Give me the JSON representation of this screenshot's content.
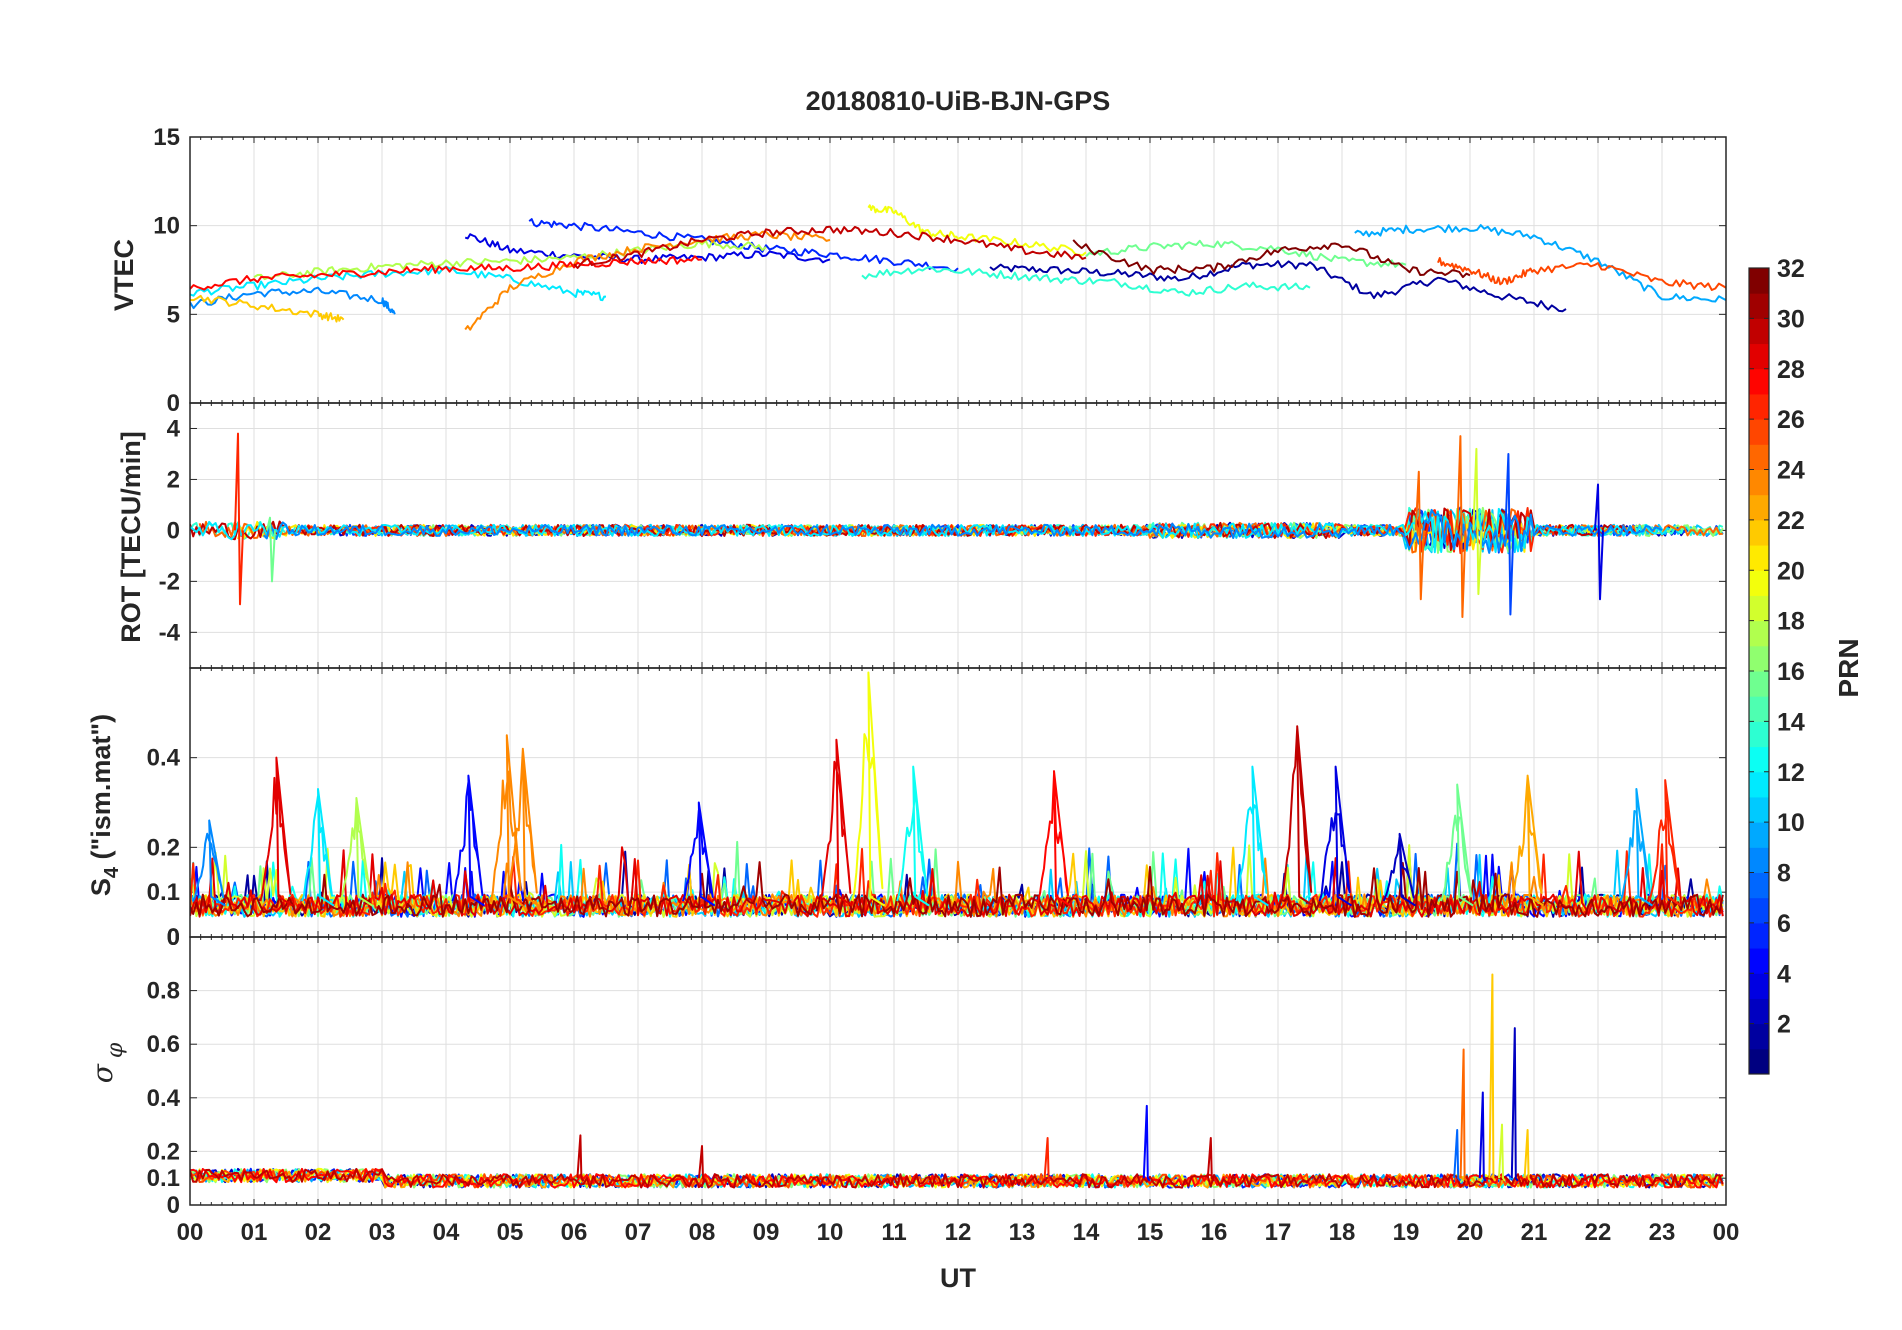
{
  "figure_title": "20180810-UiB-BJN-GPS",
  "colorbar": {
    "label": "PRN",
    "min": 1,
    "max": 32,
    "colormap": "jet",
    "ticks": [
      "2",
      "4",
      "6",
      "8",
      "10",
      "12",
      "14",
      "16",
      "18",
      "20",
      "22",
      "24",
      "26",
      "28",
      "30",
      "32"
    ]
  },
  "chart_data": [
    {
      "type": "line",
      "panel": "VTEC",
      "title": "20180810-UiB-BJN-GPS",
      "ylabel": "VTEC",
      "xlim": [
        0,
        24
      ],
      "ylim": [
        0,
        15
      ],
      "yticks": [
        0,
        5,
        10,
        15
      ],
      "grid": true,
      "series_by_prn": [
        {
          "prn": 2,
          "x": [
            12.5,
            13.5,
            14.5,
            15.5,
            16.5,
            17.5,
            18.5,
            19.5,
            20.5,
            21.5
          ],
          "y": [
            7.6,
            7.5,
            7.3,
            7.0,
            7.8,
            7.8,
            6.0,
            7.0,
            6.0,
            5.3
          ]
        },
        {
          "prn": 4,
          "x": [
            4.3,
            5.0,
            6.0,
            7.0,
            8.0,
            9.0,
            10.0
          ],
          "y": [
            9.5,
            8.6,
            8.3,
            8.1,
            8.2,
            8.4,
            8.1
          ]
        },
        {
          "prn": 6,
          "x": [
            5.3,
            6.0,
            7.0,
            8.0,
            9.0,
            10.0,
            11.0,
            12.0
          ],
          "y": [
            10.2,
            10.0,
            9.6,
            9.2,
            8.7,
            8.4,
            8.0,
            7.6
          ]
        },
        {
          "prn": 9,
          "x": [
            0.0,
            1.0,
            2.0,
            3.0,
            3.2
          ],
          "y": [
            5.5,
            6.2,
            6.3,
            5.8,
            5.0
          ]
        },
        {
          "prn": 10,
          "x": [
            18.2,
            19.0,
            20.0,
            21.0,
            22.0,
            23.0,
            24.0
          ],
          "y": [
            9.5,
            9.8,
            9.9,
            9.4,
            8.0,
            6.0,
            5.8
          ]
        },
        {
          "prn": 12,
          "x": [
            0.0,
            1.0,
            2.0,
            3.0,
            4.0,
            5.0,
            6.0,
            6.5
          ],
          "y": [
            6.2,
            6.6,
            7.0,
            7.3,
            7.5,
            7.0,
            6.2,
            6.0
          ]
        },
        {
          "prn": 14,
          "x": [
            10.5,
            11.5,
            12.5,
            13.5,
            14.5,
            15.5,
            16.5,
            17.5
          ],
          "y": [
            7.2,
            7.6,
            7.3,
            7.0,
            6.8,
            6.2,
            6.6,
            6.5
          ]
        },
        {
          "prn": 16,
          "x": [
            14.0,
            15.0,
            16.0,
            17.0,
            18.0,
            19.0
          ],
          "y": [
            8.4,
            8.8,
            9.0,
            8.7,
            8.0,
            7.8
          ]
        },
        {
          "prn": 18,
          "x": [
            1.0,
            2.0,
            3.0,
            4.0,
            5.0,
            6.0,
            7.0,
            8.0,
            9.0
          ],
          "y": [
            7.0,
            7.4,
            7.7,
            7.9,
            8.0,
            8.2,
            8.6,
            9.0,
            8.8
          ]
        },
        {
          "prn": 20,
          "x": [
            10.6,
            11.0,
            11.5,
            12.0,
            13.0,
            14.0
          ],
          "y": [
            11.0,
            10.8,
            9.6,
            9.4,
            9.0,
            8.5
          ]
        },
        {
          "prn": 22,
          "x": [
            0.0,
            1.0,
            2.0,
            2.4
          ],
          "y": [
            6.0,
            5.5,
            5.0,
            4.7
          ]
        },
        {
          "prn": 24,
          "x": [
            4.3,
            5.0,
            6.0,
            7.0,
            8.0,
            9.0,
            10.0
          ],
          "y": [
            4.0,
            6.5,
            8.0,
            8.7,
            9.2,
            9.5,
            9.2
          ]
        },
        {
          "prn": 26,
          "x": [
            19.5,
            20.0,
            20.5,
            21.0,
            22.0,
            23.0,
            24.0
          ],
          "y": [
            8.0,
            7.5,
            6.8,
            7.5,
            7.8,
            6.8,
            6.5
          ]
        },
        {
          "prn": 28,
          "x": [
            0.0,
            1.0,
            2.0,
            3.0,
            4.0,
            5.0,
            6.0,
            7.0,
            8.0
          ],
          "y": [
            6.5,
            7.0,
            7.2,
            7.4,
            7.6,
            7.6,
            7.8,
            8.0,
            8.1
          ]
        },
        {
          "prn": 30,
          "x": [
            6.0,
            7.0,
            8.0,
            9.0,
            10.0,
            11.0,
            12.0,
            13.0,
            14.0
          ],
          "y": [
            7.8,
            8.4,
            9.2,
            9.6,
            9.8,
            9.6,
            9.2,
            8.6,
            8.2
          ]
        },
        {
          "prn": 32,
          "x": [
            13.8,
            15.0,
            16.0,
            17.0,
            18.0,
            19.0,
            20.0
          ],
          "y": [
            9.0,
            7.5,
            7.6,
            8.6,
            9.0,
            7.5,
            7.2
          ]
        }
      ]
    },
    {
      "type": "line",
      "panel": "ROT",
      "ylabel": "ROT [TECU/min]",
      "xlim": [
        0,
        24
      ],
      "ylim": [
        -5.4,
        5.0
      ],
      "yticks": [
        -4,
        -2,
        0,
        2,
        4
      ],
      "grid": true,
      "baseline": 0,
      "spikes": [
        {
          "x": 0.75,
          "max": 3.8,
          "min": -2.9,
          "prn": 27
        },
        {
          "x": 1.25,
          "max": 0.5,
          "min": -2.0,
          "prn": 16
        },
        {
          "x": 19.2,
          "max": 2.3,
          "min": -2.7,
          "prn": 25
        },
        {
          "x": 19.85,
          "max": 3.7,
          "min": -3.4,
          "prn": 25
        },
        {
          "x": 20.1,
          "max": 3.2,
          "min": -2.5,
          "prn": 19
        },
        {
          "x": 20.6,
          "max": 3.0,
          "min": -3.3,
          "prn": 7
        },
        {
          "x": 22.0,
          "max": 1.8,
          "min": -2.7,
          "prn": 4
        }
      ]
    },
    {
      "type": "line",
      "panel": "S4",
      "ylabel": "S4 (\"ism.mat\")",
      "xlim": [
        0,
        24
      ],
      "ylim": [
        0,
        0.6
      ],
      "yticks": [
        0,
        0.1,
        0.2,
        0.4
      ],
      "grid": true,
      "peaks": [
        {
          "x": 0.3,
          "y": 0.26,
          "prn": 9
        },
        {
          "x": 1.35,
          "y": 0.4,
          "prn": 29
        },
        {
          "x": 2.0,
          "y": 0.33,
          "prn": 12
        },
        {
          "x": 2.6,
          "y": 0.31,
          "prn": 18
        },
        {
          "x": 4.35,
          "y": 0.36,
          "prn": 5
        },
        {
          "x": 4.95,
          "y": 0.45,
          "prn": 24
        },
        {
          "x": 5.2,
          "y": 0.42,
          "prn": 24
        },
        {
          "x": 7.95,
          "y": 0.3,
          "prn": 5
        },
        {
          "x": 10.1,
          "y": 0.44,
          "prn": 29
        },
        {
          "x": 10.6,
          "y": 0.59,
          "prn": 20
        },
        {
          "x": 11.3,
          "y": 0.38,
          "prn": 13
        },
        {
          "x": 13.5,
          "y": 0.37,
          "prn": 28
        },
        {
          "x": 16.6,
          "y": 0.38,
          "prn": 12
        },
        {
          "x": 17.3,
          "y": 0.47,
          "prn": 30
        },
        {
          "x": 17.9,
          "y": 0.38,
          "prn": 4
        },
        {
          "x": 18.9,
          "y": 0.23,
          "prn": 3
        },
        {
          "x": 19.8,
          "y": 0.34,
          "prn": 16
        },
        {
          "x": 20.9,
          "y": 0.36,
          "prn": 23
        },
        {
          "x": 22.6,
          "y": 0.33,
          "prn": 10
        },
        {
          "x": 23.05,
          "y": 0.35,
          "prn": 27
        }
      ]
    },
    {
      "type": "line",
      "panel": "sigma_phi",
      "ylabel": "σ φ",
      "xlim": [
        0,
        24
      ],
      "ylim": [
        0,
        1.0
      ],
      "yticks": [
        0,
        0.1,
        0.2,
        0.4,
        0.6,
        0.8
      ],
      "grid": true,
      "peaks": [
        {
          "x": 6.1,
          "y": 0.26,
          "prn": 30
        },
        {
          "x": 8.0,
          "y": 0.22,
          "prn": 30
        },
        {
          "x": 13.4,
          "y": 0.25,
          "prn": 27
        },
        {
          "x": 14.95,
          "y": 0.37,
          "prn": 5
        },
        {
          "x": 15.95,
          "y": 0.25,
          "prn": 30
        },
        {
          "x": 19.8,
          "y": 0.28,
          "prn": 8
        },
        {
          "x": 19.9,
          "y": 0.58,
          "prn": 25
        },
        {
          "x": 20.2,
          "y": 0.42,
          "prn": 4
        },
        {
          "x": 20.35,
          "y": 0.86,
          "prn": 22
        },
        {
          "x": 20.5,
          "y": 0.3,
          "prn": 19
        },
        {
          "x": 20.7,
          "y": 0.66,
          "prn": 3
        },
        {
          "x": 20.9,
          "y": 0.28,
          "prn": 22
        }
      ]
    }
  ],
  "x_axis": {
    "label": "UT",
    "min": 0,
    "max": 24,
    "ticks": [
      "00",
      "01",
      "02",
      "03",
      "04",
      "05",
      "06",
      "07",
      "08",
      "09",
      "10",
      "11",
      "12",
      "13",
      "14",
      "15",
      "16",
      "17",
      "18",
      "19",
      "20",
      "21",
      "22",
      "23",
      "00"
    ]
  },
  "panels": {
    "vtec": {
      "ylabel": "VTEC",
      "ticks": [
        "0",
        "5",
        "10",
        "15"
      ]
    },
    "rot": {
      "ylabel": "ROT [TECU/min]",
      "ticks": [
        "-4",
        "-2",
        "0",
        "2",
        "4"
      ]
    },
    "s4": {
      "ylabel_main": "S",
      "ylabel_sub": "4",
      "ylabel_rest": " (\"ism.mat\")",
      "ticks": [
        "0",
        "0.1",
        "0.2",
        "0.4"
      ],
      "bottom_tick": "0"
    },
    "sigma": {
      "ylabel_sigma": "σ",
      "ylabel_phi": "φ",
      "ticks": [
        "0",
        "0.1",
        "0.2",
        "0.4",
        "0.6",
        "0.8"
      ]
    }
  }
}
